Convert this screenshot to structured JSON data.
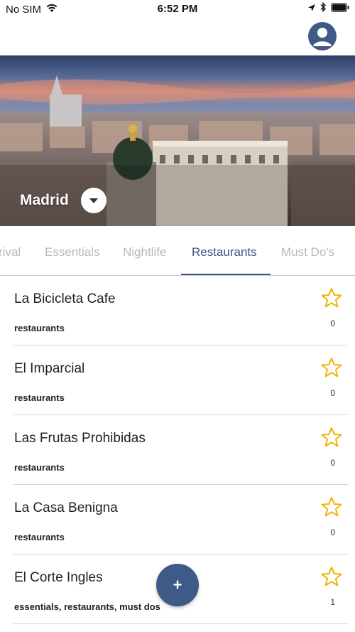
{
  "status_bar": {
    "carrier": "No SIM",
    "time": "6:52 PM",
    "icons": [
      "wifi-icon",
      "location-arrow-icon",
      "bluetooth-icon",
      "battery-icon"
    ]
  },
  "header": {
    "profile_icon": "user-profile-icon"
  },
  "hero": {
    "city": "Madrid",
    "dropdown_icon": "caret-down-icon"
  },
  "tabs": [
    {
      "label": "rival",
      "active": false
    },
    {
      "label": "Essentials",
      "active": false
    },
    {
      "label": "Nightlife",
      "active": false
    },
    {
      "label": "Restaurants",
      "active": true
    },
    {
      "label": "Must Do's",
      "active": false
    }
  ],
  "places": [
    {
      "name": "La Bicicleta Cafe",
      "tags": "restaurants",
      "favorites": "0"
    },
    {
      "name": "El Imparcial",
      "tags": "restaurants",
      "favorites": "0"
    },
    {
      "name": "Las Frutas Prohibidas",
      "tags": "restaurants",
      "favorites": "0"
    },
    {
      "name": "La Casa Benigna",
      "tags": "restaurants",
      "favorites": "0"
    },
    {
      "name": "El Corte Ingles",
      "tags": "essentials, restaurants, must dos",
      "favorites": "1"
    }
  ],
  "fab": {
    "label": "+"
  },
  "colors": {
    "accent": "#3a5683",
    "star": "#f0b400",
    "inactive_tab": "#b8b8b8"
  }
}
